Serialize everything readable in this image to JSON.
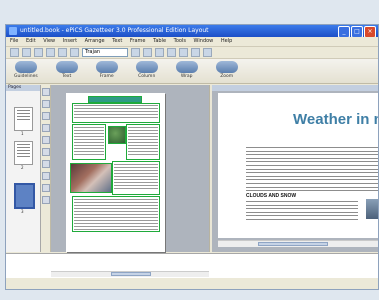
{
  "window": {
    "title": "untitled.book - ePiCS Gazetteer 3.0 Professional Edition Layout",
    "controls": [
      "_",
      "□",
      "×"
    ]
  },
  "menubar": {
    "items": [
      "File",
      "Edit",
      "View",
      "Insert",
      "Arrange",
      "Text",
      "Frame",
      "Table",
      "Tools",
      "Window",
      "Help"
    ]
  },
  "toolbar": {
    "font_value": "Trajan"
  },
  "big_toolbar": {
    "tools": [
      "Guidelines",
      "Text",
      "Frame",
      "Column",
      "Wrap",
      "Zoom"
    ]
  },
  "pages_panel": {
    "header": "Pages",
    "page_numbers": [
      "1",
      "2",
      "3"
    ]
  },
  "document": {
    "headline": "Weather in m",
    "subheading": "CLOUDS AND SNOW"
  }
}
